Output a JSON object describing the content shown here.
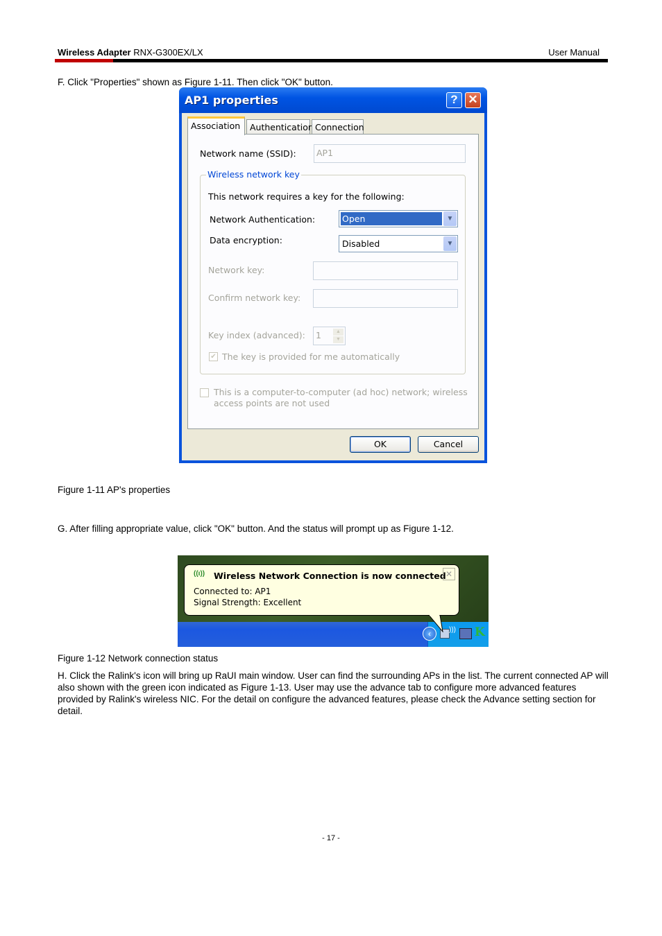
{
  "header": {
    "product_bold": "Wireless Adapter",
    "product_model": " RNX-G300EX/LX",
    "doc_type": "User Manual",
    "accent_color": "#c00000"
  },
  "steps": {
    "f": "F. Click \"Properties\" shown as Figure 1-11. Then click \"OK\" button.",
    "g": "G. After filling appropriate value, click \"OK\" button. And the status will prompt up as Figure 1-12.",
    "h": "H. Click the Ralink's icon will bring up RaUI main window. User can find the surrounding APs in the list. The current connected AP will also shown with the green icon indicated as Figure 1-13. User may use the advance tab to configure more advanced features provided by Ralink's wireless NIC. For the detail on configure the advanced features, please check the Advance setting section for detail."
  },
  "figure_1_11": {
    "caption": "Figure 1-11 AP's properties",
    "dialog": {
      "title": "AP1 properties",
      "help_glyph": "?",
      "close_glyph": "✕",
      "tabs": [
        {
          "label": "Association",
          "active": true
        },
        {
          "label": "Authentication",
          "active": false
        },
        {
          "label": "Connection",
          "active": false
        }
      ],
      "ssid_label": "Network name (SSID):",
      "ssid_value": "AP1",
      "group_title": "Wireless network key",
      "requires_text": "This network requires a key for the following:",
      "auth_label": "Network Authentication:",
      "auth_value": "Open",
      "encryption_label": "Data encryption:",
      "encryption_value": "Disabled",
      "network_key_label": "Network key:",
      "network_key_value": "",
      "confirm_key_label": "Confirm network key:",
      "confirm_key_value": "",
      "key_index_label": "Key index (advanced):",
      "key_index_value": "1",
      "auto_key_label": "The key is provided for me automatically",
      "auto_key_checked": true,
      "adhoc_label_line1": "This is a computer-to-computer (ad hoc) network; wireless",
      "adhoc_label_line2": "access points are not used",
      "adhoc_checked": false,
      "ok_label": "OK",
      "cancel_label": "Cancel"
    }
  },
  "figure_1_12": {
    "caption": "Figure 1-12 Network connection status",
    "balloon": {
      "title": "Wireless Network Connection is now connected",
      "connected_to": "Connected to: AP1",
      "signal": "Signal Strength: Excellent",
      "close_glyph": "✕"
    }
  },
  "footer": {
    "page_number": "- 17 -"
  }
}
